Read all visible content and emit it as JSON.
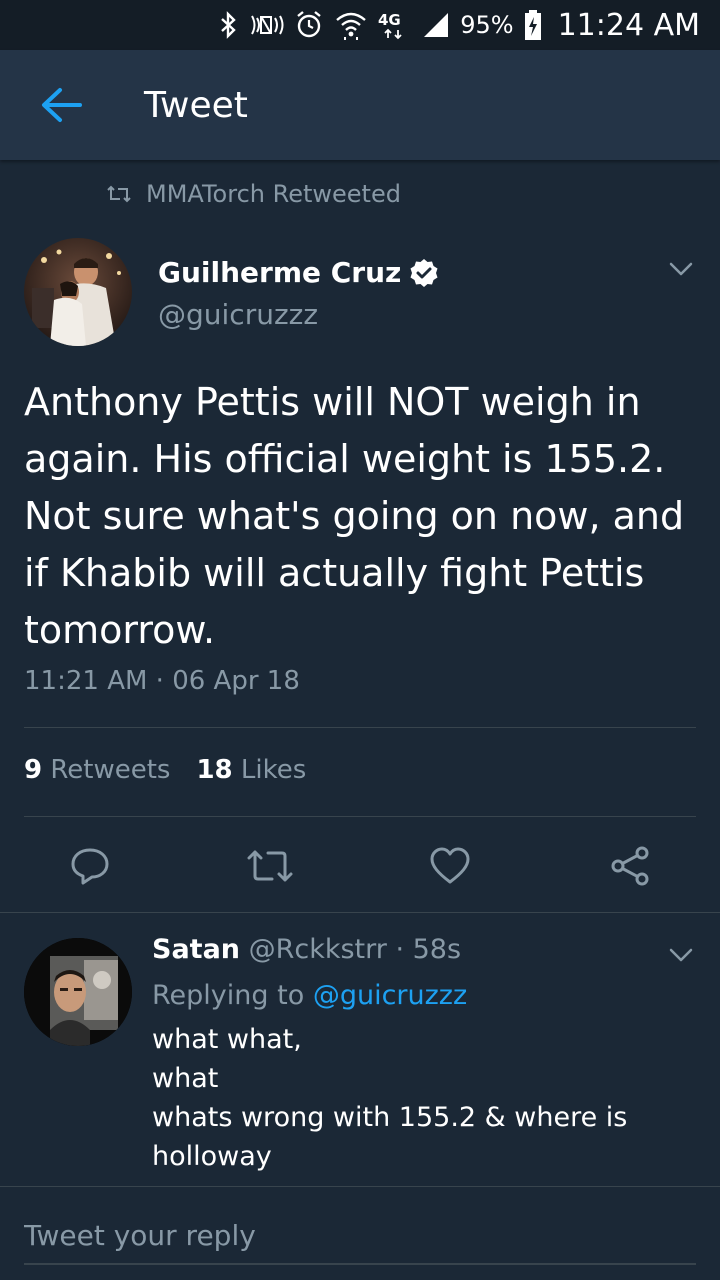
{
  "status_bar": {
    "battery": "95%",
    "network": "4G",
    "time": "11:24 AM",
    "icons": [
      "bluetooth-icon",
      "nfc-icon",
      "alarm-icon",
      "wifi-icon",
      "network-4g-icon",
      "signal-icon",
      "battery-charging-icon"
    ]
  },
  "header": {
    "title": "Tweet",
    "back_icon": "arrow-left-icon"
  },
  "retweet_context": {
    "icon": "retweet-icon",
    "text": "MMATorch Retweeted"
  },
  "tweet": {
    "author_name": "Guilherme Cruz",
    "verified": true,
    "handle": "@guicruzzz",
    "text": "Anthony Pettis will NOT weigh in again. His official weight is 155.2. Not sure what's going on now, and if Khabib will actually fight Pettis tomorrow.",
    "timestamp": "11:21 AM · 06 Apr 18",
    "retweets_count": "9",
    "retweets_label": "Retweets",
    "likes_count": "18",
    "likes_label": "Likes"
  },
  "actions": [
    "reply-icon",
    "retweet-icon",
    "like-icon",
    "share-icon"
  ],
  "reply": {
    "author_name": "Satan",
    "handle": "@Rckkstrr",
    "age": "· 58s",
    "replying_label": "Replying to",
    "replying_to": "@guicruzzz",
    "text": "what what,\nwhat\nwhats wrong with 155.2 & where is holloway"
  },
  "compose": {
    "placeholder": "Tweet your reply"
  },
  "colors": {
    "background": "#1b2836",
    "header": "#243447",
    "status_bar": "#141d26",
    "accent": "#1da1f2",
    "secondary_text": "#8899a6",
    "divider": "#38444d"
  }
}
